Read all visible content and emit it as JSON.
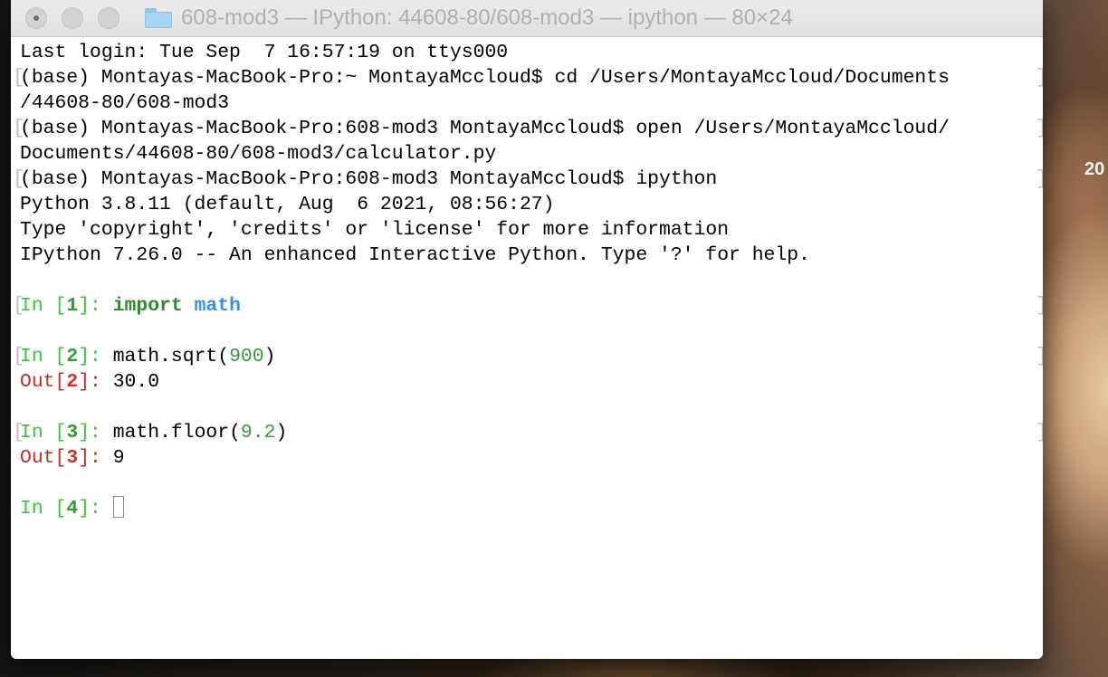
{
  "window": {
    "title": "608-mod3 — IPython: 44608-80/608-mod3 — ipython — 80×24"
  },
  "desktop": {
    "clock_partial": "20"
  },
  "terminal": {
    "lines": [
      "Last login: Tue Sep  7 16:57:19 on ttys000",
      "(base) Montayas-MacBook-Pro:~ MontayaMccloud$ cd /Users/MontayaMccloud/Documents",
      "/44608-80/608-mod3",
      "(base) Montayas-MacBook-Pro:608-mod3 MontayaMccloud$ open /Users/MontayaMccloud/",
      "Documents/44608-80/608-mod3/calculator.py",
      "(base) Montayas-MacBook-Pro:608-mod3 MontayaMccloud$ ipython",
      "Python 3.8.11 (default, Aug  6 2021, 08:56:27)",
      "Type 'copyright', 'credits' or 'license' for more information",
      "IPython 7.26.0 -- An enhanced Interactive Python. Type '?' for help."
    ],
    "cells": [
      {
        "in_label": "In [",
        "num": "1",
        "close": "]: ",
        "kw": "import",
        "space": " ",
        "module": "math"
      },
      {
        "in_label": "In [",
        "num": "2",
        "close": "]: ",
        "code_pre": "math.sqrt(",
        "arg": "900",
        "code_post": ")",
        "out_label": "Out[",
        "out_num": "2",
        "out_close": "]: ",
        "out_value": "30.0"
      },
      {
        "in_label": "In [",
        "num": "3",
        "close": "]: ",
        "code_pre": "math.floor(",
        "arg": "9.2",
        "code_post": ")",
        "out_label": "Out[",
        "out_num": "3",
        "out_close": "]: ",
        "out_value": "9"
      },
      {
        "in_label": "In [",
        "num": "4",
        "close": "]: "
      }
    ]
  },
  "colors": {
    "prompt_green": "#37c837",
    "keyword_green": "#2e8b2e",
    "module_blue": "#3b8eea",
    "out_red": "#c0312b"
  }
}
